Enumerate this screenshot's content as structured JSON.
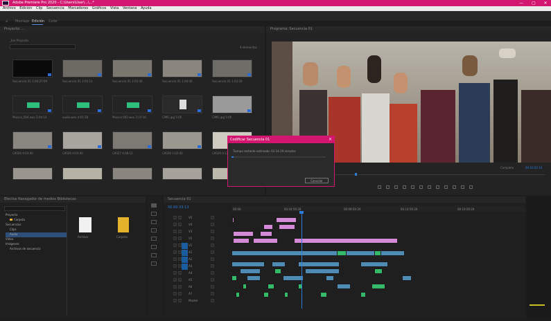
{
  "window": {
    "title": "Adobe Premiere Pro 2020 - C:\\Users\\User\\...\\...*",
    "controls": [
      "—",
      "▢",
      "✕"
    ]
  },
  "menu": [
    "Archivo",
    "Edición",
    "Clip",
    "Secuencia",
    "Marcadores",
    "Gráficos",
    "Vista",
    "Ventana",
    "Ayuda"
  ],
  "workspaces": [
    "Montaje",
    "Edición",
    "Color",
    "Efectos",
    "Audio",
    "Gráficos",
    "Bibliotecas"
  ],
  "project": {
    "title": "Proyecto: ...",
    "bin": "_bin Proyecto",
    "item_count": "9 elementos",
    "thumbnails": [
      {
        "label": "Secuencia 01",
        "dur": "1:00:27:09"
      },
      {
        "label": "Secuencia 01",
        "dur": "2:05:13"
      },
      {
        "label": "Secuencia 01",
        "dur": "2:02:00"
      },
      {
        "label": "Secuencia 01",
        "dur": "2:00:00"
      },
      {
        "label": "Secuencia 01",
        "dur": "1:02:20"
      },
      {
        "label": "Música_004.wav",
        "dur": "2:04:14"
      },
      {
        "label": "audio.wav",
        "dur": "4:01:28"
      },
      {
        "label": "Música 002.wav",
        "dur": "3:15:16"
      },
      {
        "label": "CIMG.jpg",
        "dur": "5:00"
      },
      {
        "label": "CIMG.jpg",
        "dur": "5:00"
      },
      {
        "label": "C0024",
        "dur": "4:03:00"
      },
      {
        "label": "C0026",
        "dur": "0:03:00"
      },
      {
        "label": "C0027",
        "dur": "4:08:12"
      },
      {
        "label": "C0028",
        "dur": "1:02:00"
      },
      {
        "label": "C0029",
        "dur": "0:12:00"
      }
    ]
  },
  "effects_panel": {
    "title": "Efectos  Navegador de medios  Bibliotecas",
    "tree": [
      "Proyecto",
      "Carpeta",
      "Secuencias",
      "Clips",
      "Audio",
      "Vídeo",
      "Imágenes",
      "Gráficos",
      "Archivos de secuencia"
    ],
    "files": [
      "Carpeta",
      "Archivo",
      "Carpeta"
    ]
  },
  "program": {
    "title": "Programa: Secuencia 01",
    "timecode_left": "00:00:33:13",
    "timecode_right": "00:10:02:16",
    "zoom": "Encajar",
    "resolution": "Completa"
  },
  "dialog": {
    "title": "Codificar Secuencia 01",
    "message": "Tiempo restante estimado: 01:14:19 minutos",
    "cancel": "Cancelar"
  },
  "timeline": {
    "title": "Secuencia 01",
    "timecode": "00:00:33:13",
    "ruler": [
      "00:00",
      "00:04:59:28",
      "00:09:59:29",
      "00:14:59:29",
      "00:19:59:29"
    ],
    "tracks": [
      "V5",
      "V4",
      "V3",
      "V2",
      "V1",
      "A1",
      "A2",
      "A3",
      "A4",
      "A5",
      "A6",
      "A7",
      "Master"
    ]
  },
  "colors": {
    "accent": "#d3166f",
    "playhead": "#2e7ad6",
    "video_clip": "#d58ad8",
    "audio_clip": "#4d8bb5",
    "green_clip": "#36b86b",
    "selected": "#1a5c9e"
  }
}
